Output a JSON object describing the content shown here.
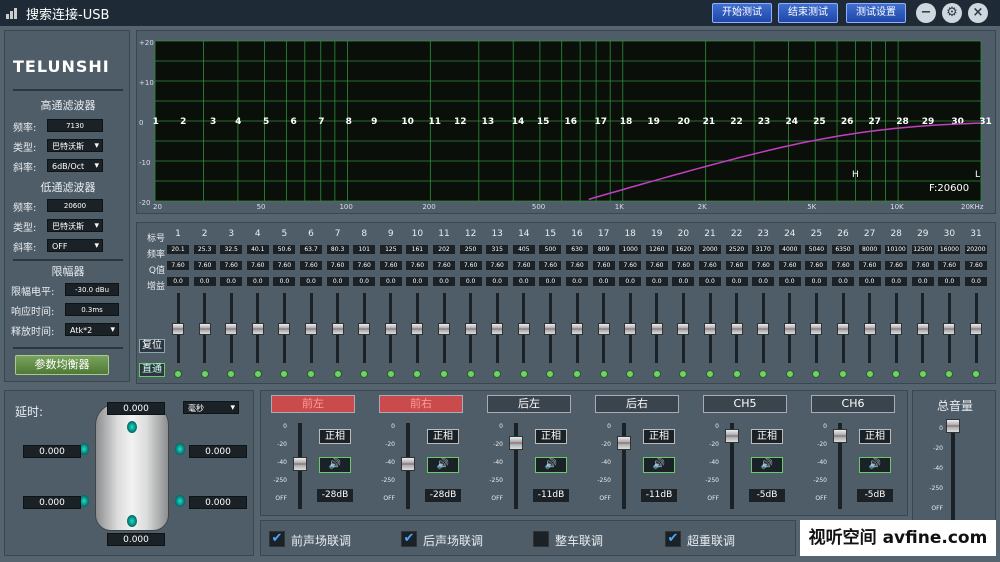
{
  "window": {
    "title": "搜索连接-USB",
    "buttons": [
      "开始测试",
      "结束测试",
      "测试设置"
    ]
  },
  "left": {
    "logo": "TELUNSHI",
    "hpf": {
      "title": "高通滤波器",
      "freq_label": "频率:",
      "freq": "7130",
      "type_label": "类型:",
      "type": "巴特沃斯",
      "slope_label": "斜率:",
      "slope": "6dB/Oct"
    },
    "lpf": {
      "title": "低通滤波器",
      "freq_label": "频率:",
      "freq": "20600",
      "type_label": "类型:",
      "type": "巴特沃斯",
      "slope_label": "斜率:",
      "slope": "OFF"
    },
    "limiter": {
      "title": "限幅器",
      "level_label": "限幅电平:",
      "level": "-30.0 dBu",
      "attack_label": "响应时间:",
      "attack": "0.3ms",
      "release_label": "释放时间:",
      "release": "Atk*2"
    },
    "eq_button": "参数均衡器"
  },
  "graph": {
    "y_ticks": [
      "+20",
      "+10",
      "0",
      "-10",
      "-20"
    ],
    "x_ticks": [
      "20",
      "50",
      "100",
      "200",
      "500",
      "1K",
      "2K",
      "5K",
      "10K",
      "20KHz"
    ],
    "band_markers": [
      "1",
      "2",
      "3",
      "4",
      "5",
      "6",
      "7",
      "8",
      "9",
      "10",
      "11",
      "12",
      "13",
      "14",
      "15",
      "16",
      "17",
      "18",
      "19",
      "20",
      "21",
      "22",
      "23",
      "24",
      "25",
      "26",
      "27",
      "28",
      "29",
      "30",
      "31"
    ],
    "h_marker": "H",
    "l_marker": "L",
    "f_readout": "F:20600",
    "curve_color": "#c040c0"
  },
  "eq": {
    "row_labels": [
      "标号",
      "频率",
      "Q值",
      "增益"
    ],
    "bands": [
      "1",
      "2",
      "3",
      "4",
      "5",
      "6",
      "7",
      "8",
      "9",
      "10",
      "11",
      "12",
      "13",
      "14",
      "15",
      "16",
      "17",
      "18",
      "19",
      "20",
      "21",
      "22",
      "23",
      "24",
      "25",
      "26",
      "27",
      "28",
      "29",
      "30",
      "31"
    ],
    "freqs": [
      "20.1",
      "25.3",
      "32.5",
      "40.1",
      "50.6",
      "63.7",
      "80.3",
      "101",
      "125",
      "161",
      "202",
      "250",
      "315",
      "405",
      "500",
      "630",
      "809",
      "1000",
      "1260",
      "1620",
      "2000",
      "2520",
      "3170",
      "4000",
      "5040",
      "6350",
      "8000",
      "10100",
      "12500",
      "16000",
      "20200"
    ],
    "q": "7.60",
    "gain": "0.0",
    "reset_label": "复位",
    "bypass_label": "直通"
  },
  "delay": {
    "title": "延时:",
    "unit": "毫秒",
    "front": "0.000",
    "left_front": "0.000",
    "right_front": "0.000",
    "left_rear": "0.000",
    "right_rear": "0.000",
    "rear": "0.000"
  },
  "channels": [
    {
      "name": "前左",
      "phase": "正相",
      "db": "-28dB",
      "level": -28,
      "style": "red"
    },
    {
      "name": "前右",
      "phase": "正相",
      "db": "-28dB",
      "level": -28,
      "style": "red"
    },
    {
      "name": "后左",
      "phase": "正相",
      "db": "-11dB",
      "level": -11,
      "style": "dark"
    },
    {
      "name": "后右",
      "phase": "正相",
      "db": "-11dB",
      "level": -11,
      "style": "dark"
    },
    {
      "name": "CH5",
      "phase": "正相",
      "db": "-5dB",
      "level": -5,
      "style": "dark"
    },
    {
      "name": "CH6",
      "phase": "正相",
      "db": "-5dB",
      "level": -5,
      "style": "dark"
    }
  ],
  "channel_ticks": [
    "0",
    "-20",
    "-40",
    "-250",
    "OFF"
  ],
  "links": [
    {
      "label": "前声场联调",
      "checked": true
    },
    {
      "label": "后声场联调",
      "checked": true
    },
    {
      "label": "整车联调",
      "checked": false
    },
    {
      "label": "超重联调",
      "checked": true
    }
  ],
  "master": {
    "title": "总音量",
    "ticks": [
      "0",
      "-20",
      "-40",
      "-250",
      "OFF"
    ],
    "off_label": "OFF"
  },
  "watermark": "视听空间 avfine.com"
}
